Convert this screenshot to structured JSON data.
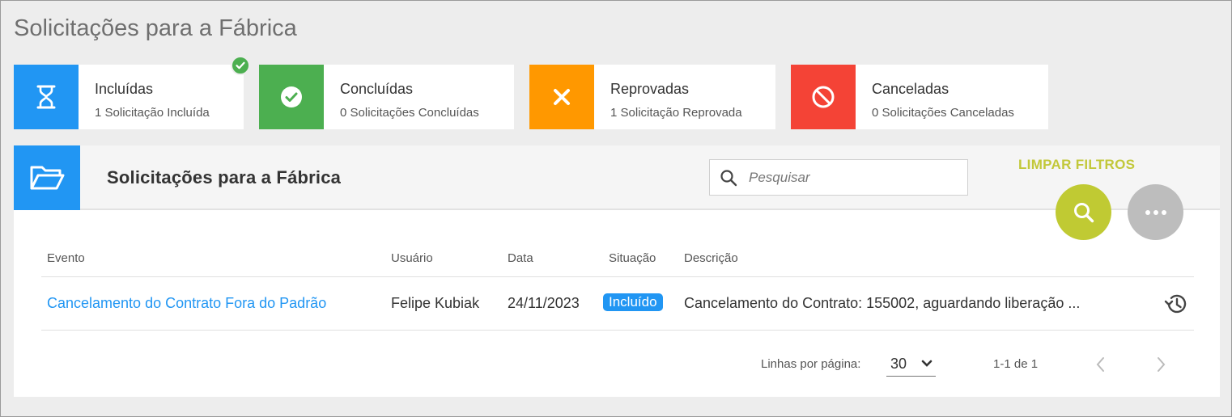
{
  "page": {
    "title": "Solicitações para a Fábrica"
  },
  "cards": [
    {
      "label": "Incluídas",
      "sub": "1 Solicitação Incluída",
      "color": "#2196f3",
      "icon": "hourglass-icon"
    },
    {
      "label": "Concluídas",
      "sub": "0 Solicitações Concluídas",
      "color": "#4caf50",
      "icon": "check-circle-icon"
    },
    {
      "label": "Reprovadas",
      "sub": "1 Solicitação Reprovada",
      "color": "#ff9800",
      "icon": "close-icon"
    },
    {
      "label": "Canceladas",
      "sub": "0 Solicitações Canceladas",
      "color": "#f44336",
      "icon": "block-icon"
    }
  ],
  "panel": {
    "title": "Solicitações para a Fábrica",
    "search_placeholder": "Pesquisar",
    "clear_filters": "LIMPAR FILTROS"
  },
  "table": {
    "headers": {
      "evento": "Evento",
      "usuario": "Usuário",
      "data": "Data",
      "situacao": "Situação",
      "descricao": "Descrição"
    },
    "rows": [
      {
        "evento": "Cancelamento do Contrato Fora do Padrão",
        "usuario": "Felipe Kubiak",
        "data": "24/11/2023",
        "situacao": "Incluído",
        "descricao": "Cancelamento do Contrato: 155002, aguardando liberação ..."
      }
    ]
  },
  "pagination": {
    "rows_label": "Linhas por página:",
    "rows_per_page": "30",
    "range": "1-1 de 1"
  },
  "colors": {
    "accent": "#2196f3",
    "lime": "#c0ca33",
    "gray_fab": "#bdbdbd"
  }
}
